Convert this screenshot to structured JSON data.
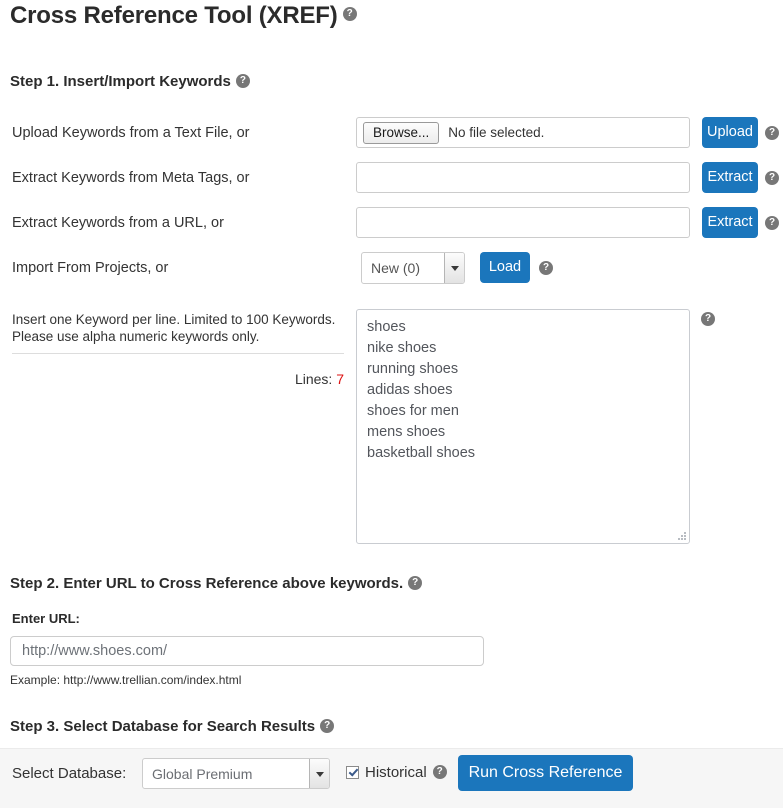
{
  "page": {
    "title": "Cross Reference Tool (XREF)",
    "help_glyph": "?"
  },
  "step1": {
    "heading": "Step 1. Insert/Import Keywords",
    "rows": [
      {
        "label": "Upload Keywords from a Text File, or",
        "button": "Upload"
      },
      {
        "label": "Extract Keywords from Meta Tags, or",
        "button": "Extract"
      },
      {
        "label": "Extract Keywords from a URL, or",
        "button": "Extract"
      },
      {
        "label": "Import From Projects, or",
        "button": "Load"
      }
    ],
    "file_input": {
      "browse_label": "Browse...",
      "status": "No file selected."
    },
    "meta_input_value": "",
    "url_input_value": "",
    "project_select": {
      "selected": "New (0)",
      "options": [
        "New (0)"
      ]
    },
    "keywords_hint_line1": "Insert one Keyword per line. Limited to 100 Keywords.",
    "keywords_hint_line2": "Please use alpha numeric keywords only.",
    "lines_label": "Lines:",
    "lines_value": "7",
    "keywords_value": "shoes\nnike shoes\nrunning shoes\nadidas shoes\nshoes for men\nmens shoes\nbasketball shoes"
  },
  "step2": {
    "heading": "Step 2. Enter URL to Cross Reference above keywords.",
    "field_label": "Enter URL:",
    "url_placeholder": "http://www.shoes.com/",
    "url_value": "http://www.shoes.com/",
    "example": "Example: http://www.trellian.com/index.html"
  },
  "step3": {
    "heading": "Step 3. Select Database for Search Results",
    "database_label": "Select Database:",
    "database_select": {
      "selected": "Global Premium",
      "options": [
        "Global Premium"
      ]
    },
    "historical_label": "Historical",
    "historical_checked": true,
    "run_button": "Run Cross Reference"
  },
  "colors": {
    "accent_blue": "#1b76bc",
    "help_gray": "#777777",
    "lines_red": "#dd1111",
    "bar_background": "#f6f6f6"
  }
}
